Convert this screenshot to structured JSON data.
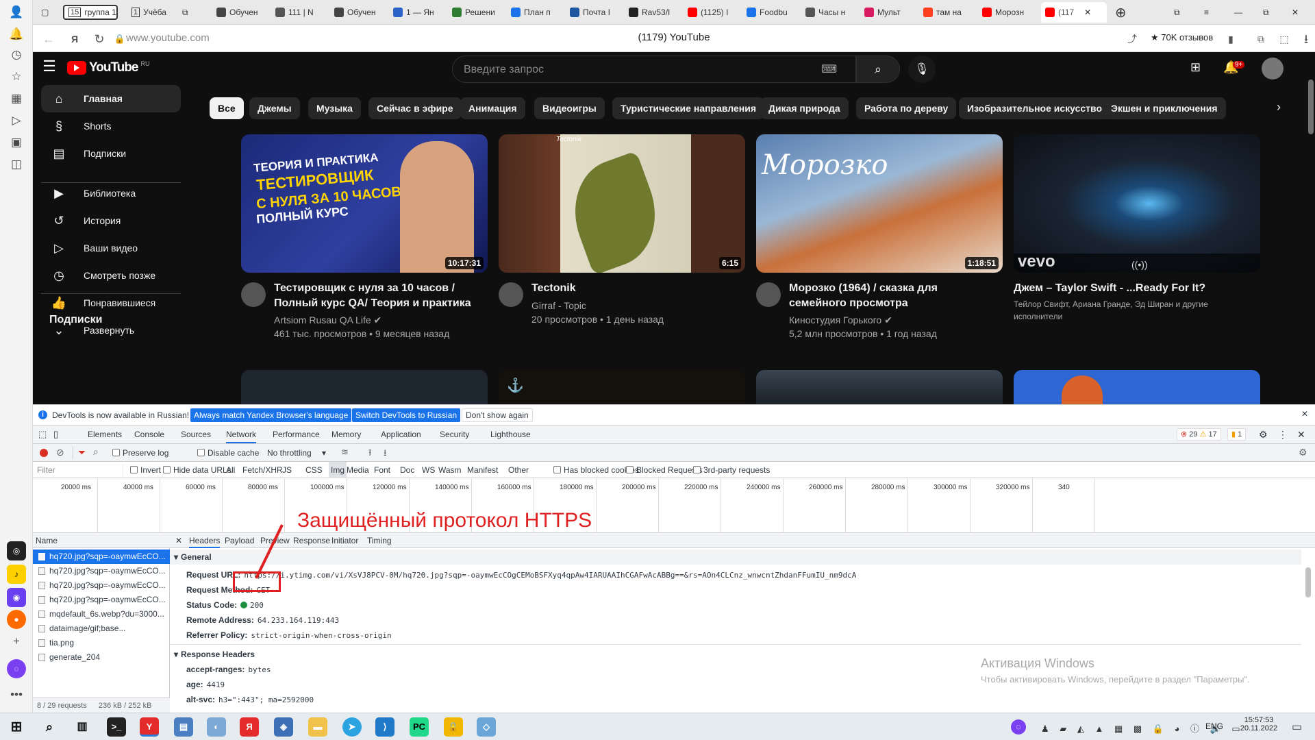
{
  "browser": {
    "group_tab": "группа 1",
    "group_tab_count": "15",
    "study_tab": "Учёба",
    "study_tab_count": "1",
    "tabs": [
      {
        "label": "Обучен",
        "color": "#444444"
      },
      {
        "label": "111 | N",
        "color": "#555555"
      },
      {
        "label": "Обучен",
        "color": "#444444"
      },
      {
        "label": "1 — Ян",
        "color": "#2b63c9"
      },
      {
        "label": "Решени",
        "color": "#2e7d32"
      },
      {
        "label": "План п",
        "color": "#1a73e8"
      },
      {
        "label": "Почта I",
        "color": "#1e56a0"
      },
      {
        "label": "Rav53/I",
        "color": "#222222"
      },
      {
        "label": "(1125) I",
        "color": "#ff0000"
      },
      {
        "label": "Foodbu",
        "color": "#1a73e8"
      },
      {
        "label": "Часы н",
        "color": "#555555"
      },
      {
        "label": "Мульт",
        "color": "#d81b60"
      },
      {
        "label": "там на",
        "color": "#fc3f1d"
      },
      {
        "label": "Морозн",
        "color": "#ff0000"
      }
    ],
    "active_tab": "(117",
    "url": "www.youtube.com",
    "page_title": "(1179) YouTube",
    "reviews": "70K отзывов"
  },
  "youtube": {
    "logo": "YouTube",
    "logo_region": "RU",
    "search_placeholder": "Введите запрос",
    "notif_count": "9+",
    "chips": [
      "Все",
      "Джемы",
      "Музыка",
      "Сейчас в эфире",
      "Анимация",
      "Видеоигры",
      "Туристические направления",
      "Дикая природа",
      "Работа по дереву",
      "Изобразительное искусство",
      "Экшен и приключения"
    ],
    "nav": [
      {
        "label": "Главная",
        "icon": "home-icon",
        "glyph": "⌂"
      },
      {
        "label": "Shorts",
        "icon": "shorts-icon",
        "glyph": "§"
      },
      {
        "label": "Подписки",
        "icon": "subscriptions-icon",
        "glyph": "▤"
      },
      {
        "label": "Библиотека",
        "icon": "library-icon",
        "glyph": "▶"
      },
      {
        "label": "История",
        "icon": "history-icon",
        "glyph": "↺"
      },
      {
        "label": "Ваши видео",
        "icon": "your-videos-icon",
        "glyph": "▷"
      },
      {
        "label": "Смотреть позже",
        "icon": "watch-later-icon",
        "glyph": "◷"
      },
      {
        "label": "Понравившиеся",
        "icon": "liked-icon",
        "glyph": "👍"
      },
      {
        "label": "Развернуть",
        "icon": "expand-icon",
        "glyph": "⌄"
      }
    ],
    "subs_heading": "Подписки",
    "videos": [
      {
        "title1": "Тестировщик с нуля за 10 часов /",
        "title2": "Полный курс QA/ Теория и практика",
        "channel": "Artsiom Rusau QA Life ✔",
        "meta": "461 тыс. просмотров • 9 месяцев назад",
        "duration": "10:17:31",
        "thumb_lines": [
          "ТЕОРИЯ И ПРАКТИКА",
          "ТЕСТИРОВЩИК",
          "С НУЛЯ ЗА 10 ЧАСОВ",
          "ПОЛНЫЙ КУРС"
        ]
      },
      {
        "title1": "Tectonik",
        "title2": "",
        "channel": "Girraf - Topic",
        "meta": "20 просмотров • 1 день назад",
        "duration": "6:15",
        "thumb_lines": [
          "Tectonik"
        ]
      },
      {
        "title1": "Морозко (1964) / сказка для",
        "title2": "семейного просмотра",
        "channel": "Киностудия Горького ✔",
        "meta": "5,2 млн просмотров • 1 год назад",
        "duration": "1:18:51",
        "thumb_lines": [
          "Морозко"
        ]
      },
      {
        "title1": "Джем – Taylor Swift - ...Ready For It?",
        "title2": "",
        "channel": "Тейлор Свифт, Ариана Гранде, Эд Ширан и другие",
        "meta": "исполнители",
        "duration": "",
        "thumb_lines": [
          "vevo"
        ]
      }
    ]
  },
  "devtools": {
    "infobar": "DevTools is now available in Russian!",
    "btn_match": "Always match Yandex Browser's language",
    "btn_switch": "Switch DevTools to Russian",
    "btn_dont": "Don't show again",
    "tabs": [
      "Elements",
      "Console",
      "Sources",
      "Network",
      "Performance",
      "Memory",
      "Application",
      "Security",
      "Lighthouse"
    ],
    "errors": "29",
    "warnings": "17",
    "issues": "1",
    "preserve_log": "Preserve log",
    "disable_cache": "Disable cache",
    "throttling": "No throttling",
    "filter_placeholder": "Filter",
    "filters": [
      "Invert",
      "Hide data URLs",
      "All",
      "Fetch/XHR",
      "JS",
      "CSS",
      "Img",
      "Media",
      "Font",
      "Doc",
      "WS",
      "Wasm",
      "Manifest",
      "Other",
      "Has blocked cookies",
      "Blocked Requests",
      "3rd-party requests"
    ],
    "timeline": [
      "20000 ms",
      "40000 ms",
      "60000 ms",
      "80000 ms",
      "100000 ms",
      "120000 ms",
      "140000 ms",
      "160000 ms",
      "180000 ms",
      "200000 ms",
      "220000 ms",
      "240000 ms",
      "260000 ms",
      "280000 ms",
      "300000 ms",
      "320000 ms",
      "340"
    ],
    "name_header": "Name",
    "requests": [
      "hq720.jpg?sqp=-oaymwEcCO...",
      "hq720.jpg?sqp=-oaymwEcCO...",
      "hq720.jpg?sqp=-oaymwEcCO...",
      "hq720.jpg?sqp=-oaymwEcCO...",
      "mqdefault_6s.webp?du=3000...",
      "dataimage/gif;base...",
      "tia.png",
      "generate_204"
    ],
    "status_bar": "8 / 29 requests",
    "status_size": "236 kB / 252 kB",
    "detail_tabs": [
      "Headers",
      "Payload",
      "Preview",
      "Response",
      "Initiator",
      "Timing"
    ],
    "general": "General",
    "request_url_label": "Request URL:",
    "request_url_proto": "https://",
    "request_url_rest": "i.ytimg.com/vi/XsVJ8PCV-0M/hq720.jpg?sqp=-oaymwEcCOgCEMoBSFXyq4qpAw4IARUAAIhCGAFwAcABBg==&rs=AOn4CLCnz_wnwcntZhdanFFumIU_nm9dcA",
    "method_label": "Request Method:",
    "method": "GET",
    "status_label": "Status Code:",
    "status": "200",
    "remote_label": "Remote Address:",
    "remote": "64.233.164.119:443",
    "referrer_label": "Referrer Policy:",
    "referrer": "strict-origin-when-cross-origin",
    "response_headers": "Response Headers",
    "rh1_label": "accept-ranges:",
    "rh1": "bytes",
    "rh2_label": "age:",
    "rh2": "4419",
    "rh3_label": "alt-svc:",
    "rh3": "h3=\":443\"; ma=2592000"
  },
  "annotation": "Защищённый протокол HTTPS",
  "watermark": {
    "line1": "Активация Windows",
    "line2": "Чтобы активировать Windows, перейдите в раздел \"Параметры\"."
  },
  "taskbar": {
    "lang": "ENG",
    "time": "15:57:53",
    "date": "20.11.2022"
  },
  "colors": {
    "accent": "#1a73e8",
    "youtube_red": "#ff0000",
    "annotation_red": "#e02020"
  }
}
